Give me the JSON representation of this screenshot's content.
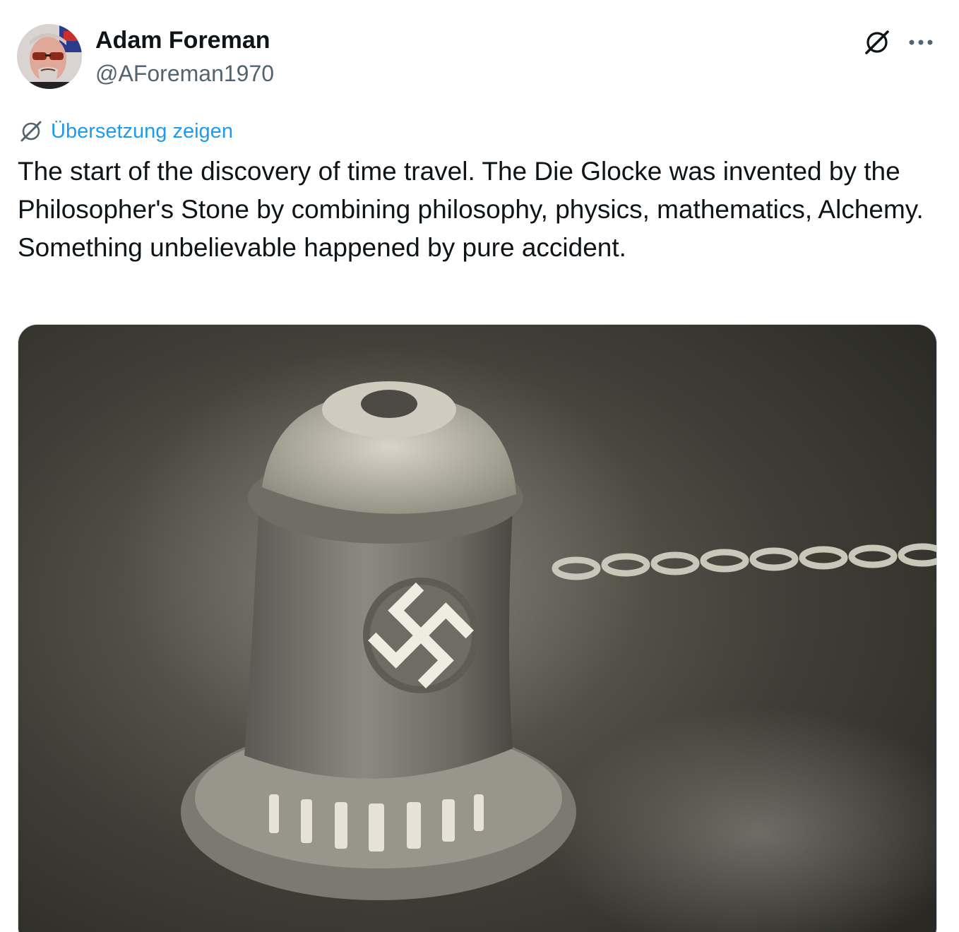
{
  "author": {
    "display_name": "Adam Foreman",
    "handle": "@AForeman1970"
  },
  "actions": {
    "grok_icon": "grok-slash-icon",
    "more_icon": "more-dots-icon"
  },
  "translate": {
    "label": "Übersetzung zeigen",
    "icon": "grok-slash-icon"
  },
  "tweet": {
    "text": "The start of the discovery of time travel. The Die Glocke was invented by the Philosopher's Stone by combining philosophy, physics, mathematics, Alchemy. Something unbelievable happened by pure accident."
  },
  "colors": {
    "link": "#1d9bf0",
    "text": "#0f1419",
    "secondary": "#536471"
  }
}
